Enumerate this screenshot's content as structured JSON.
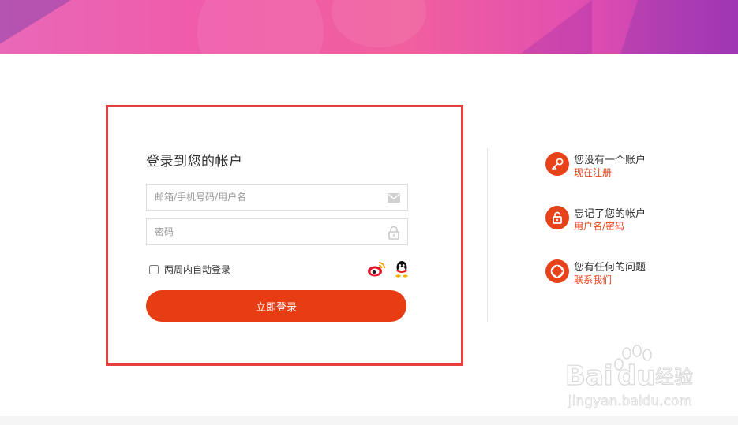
{
  "login": {
    "title": "登录到您的帐户",
    "username_placeholder": "邮箱/手机号码/用户名",
    "password_placeholder": "密码",
    "remember_label": "两周内自动登录",
    "submit_label": "立即登录"
  },
  "help": [
    {
      "title": "您没有一个账户",
      "link": "现在注册",
      "icon": "key-icon"
    },
    {
      "title": "忘记了您的帐户",
      "link": "用户名/密码",
      "icon": "unlock-icon"
    },
    {
      "title": "您有任何的问题",
      "link": "联系我们",
      "icon": "lifebuoy-icon"
    }
  ],
  "social": {
    "weibo_icon": "weibo-icon",
    "qq_icon": "qq-icon"
  },
  "watermark": {
    "brand": "Bai du 经验",
    "url": "jingyan.baidu.com"
  },
  "colors": {
    "accent": "#e83c12",
    "frame": "#e8403e",
    "banner_start": "#e968b8",
    "banner_end": "#b33ab8"
  }
}
